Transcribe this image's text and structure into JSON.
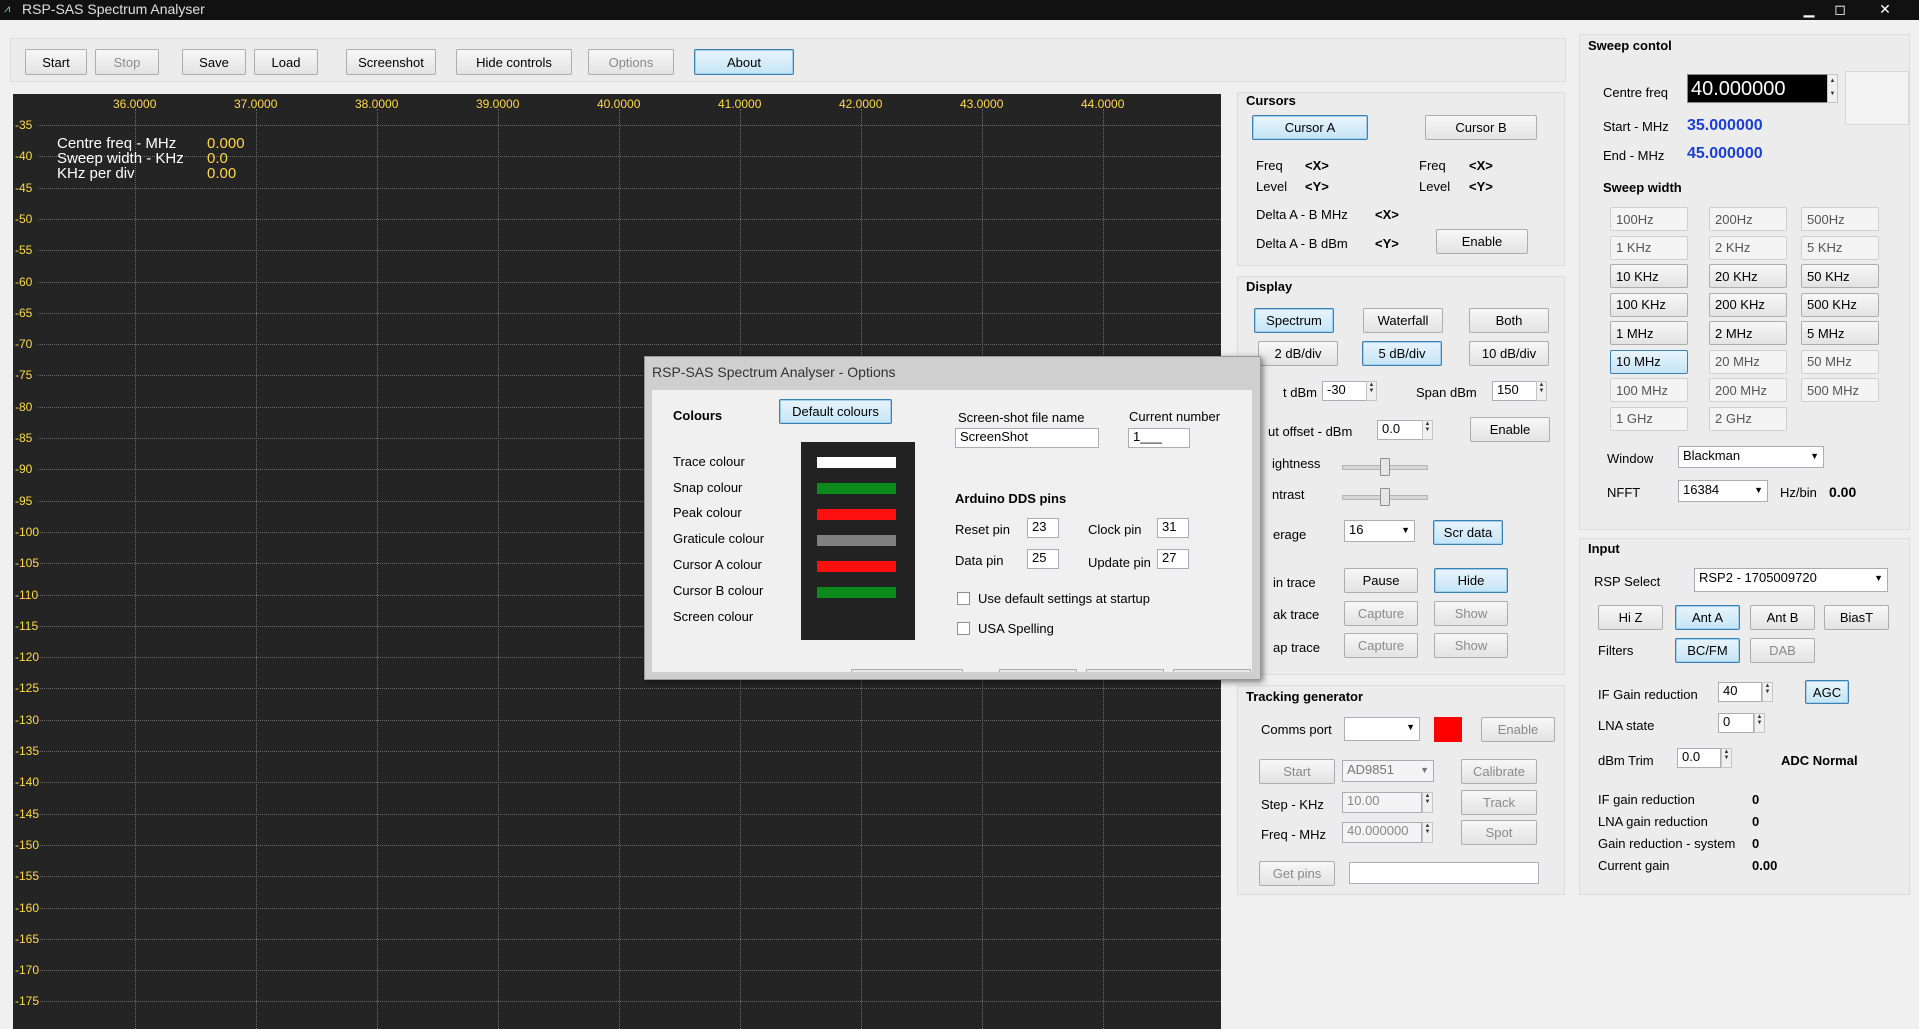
{
  "window": {
    "title": "RSP-SAS Spectrum Analyser",
    "min": "▁",
    "max": "◻",
    "close": "✕"
  },
  "toolbar": {
    "start": "Start",
    "stop": "Stop",
    "save": "Save",
    "load": "Load",
    "screenshot": "Screenshot",
    "hide_controls": "Hide controls",
    "options": "Options",
    "about": "About"
  },
  "spectrum": {
    "x_ticks": [
      "36.0000",
      "37.0000",
      "38.0000",
      "39.0000",
      "40.0000",
      "41.0000",
      "42.0000",
      "43.0000",
      "44.0000"
    ],
    "y_ticks": [
      "-35",
      "-40",
      "-45",
      "-50",
      "-55",
      "-60",
      "-65",
      "-70",
      "-75",
      "-80",
      "-85",
      "-90",
      "-95",
      "-100",
      "-105",
      "-110",
      "-115",
      "-120",
      "-125",
      "-130",
      "-135",
      "-140",
      "-145",
      "-150",
      "-155",
      "-160",
      "-165",
      "-170",
      "-175"
    ],
    "info": {
      "centre_label": "Centre freq - MHz",
      "centre_val": "0.000",
      "sweep_label": "Sweep width - KHz",
      "sweep_val": "0.0",
      "kpd_label": "KHz per div",
      "kpd_val": "0.00"
    },
    "colors": {
      "background": "#242424",
      "ticks": "#ffd84a",
      "grid": "#6a6a6a"
    }
  },
  "cursors": {
    "title": "Cursors",
    "cursor_a": "Cursor A",
    "cursor_b": "Cursor B",
    "freq": "Freq",
    "level": "Level",
    "x": "<X>",
    "y": "<Y>",
    "delta_mhz": "Delta A - B MHz",
    "delta_dbm": "Delta A - B dBm",
    "enable": "Enable"
  },
  "display": {
    "title": "Display",
    "spectrum": "Spectrum",
    "waterfall": "Waterfall",
    "both": "Both",
    "db2": "2 dB/div",
    "db5": "5 dB/div",
    "db10": "10 dB/div",
    "ref_label": "t dBm",
    "ref_val": "-30",
    "span_label": "Span dBm",
    "span_val": "150",
    "offset_label": "ut offset - dBm",
    "offset_val": "0.0",
    "enable": "Enable",
    "brightness": "ightness",
    "contrast": "ntrast",
    "brightness_level": 0.5,
    "contrast_level": 0.5,
    "average": "erage",
    "average_val": "16",
    "scr_data": "Scr data",
    "main_trace": "in trace",
    "pause": "Pause",
    "hide": "Hide",
    "peak_trace": "ak trace",
    "capture": "Capture",
    "show": "Show",
    "snap_trace": "ap trace"
  },
  "tracking": {
    "title": "Tracking generator",
    "comms": "Comms port",
    "enable": "Enable",
    "start": "Start",
    "chip": "AD9851",
    "calibrate": "Calibrate",
    "step_label": "Step - KHz",
    "step_val": "10.00",
    "track": "Track",
    "freq_label": "Freq - MHz",
    "freq_val": "40.000000",
    "spot": "Spot",
    "get_pins": "Get pins",
    "status_color": "#ff0000"
  },
  "sweep": {
    "title": "Sweep contol",
    "centre_label": "Centre freq",
    "centre_val": "40.000000",
    "start_label": "Start - MHz",
    "start_val": "35.000000",
    "end_label": "End - MHz",
    "end_val": "45.000000",
    "width_title": "Sweep width",
    "widths": [
      "100Hz",
      "200Hz",
      "500Hz",
      "1 KHz",
      "2 KHz",
      "5 KHz",
      "10 KHz",
      "20 KHz",
      "50 KHz",
      "100 KHz",
      "200 KHz",
      "500 KHz",
      "1 MHz",
      "2 MHz",
      "5 MHz",
      "10 MHz",
      "20 MHz",
      "50 MHz",
      "100 MHz",
      "200 MHz",
      "500 MHz",
      "1 GHz",
      "2 GHz"
    ],
    "window_label": "Window",
    "window_val": "Blackman",
    "nfft_label": "NFFT",
    "nfft_val": "16384",
    "hzbin_label": "Hz/bin",
    "hzbin_val": "0.00"
  },
  "input": {
    "title": "Input",
    "rsp_label": "RSP Select",
    "rsp_val": "RSP2 - 1705009720",
    "hiz": "Hi Z",
    "ant_a": "Ant A",
    "ant_b": "Ant B",
    "biast": "BiasT",
    "filters": "Filters",
    "bcfm": "BC/FM",
    "dab": "DAB",
    "if_gain_label": "IF Gain reduction",
    "if_gain_val": "40",
    "agc": "AGC",
    "lna_label": "LNA state",
    "lna_val": "0",
    "trim_label": "dBm Trim",
    "trim_val": "0.0",
    "adc": "ADC Normal",
    "if_red_label": "IF gain reduction",
    "if_red_val": "0",
    "lna_red_label": "LNA gain reduction",
    "lna_red_val": "0",
    "sys_red_label": "Gain reduction - system",
    "sys_red_val": "0",
    "cur_gain_label": "Current gain",
    "cur_gain_val": "0.00"
  },
  "options_dialog": {
    "title": "RSP-SAS Spectrum Analyser - Options",
    "colours": "Colours",
    "default_colours": "Default colours",
    "trace": "Trace colour",
    "snap": "Snap colour",
    "peak": "Peak colour",
    "graticule": "Graticule colour",
    "cursor_a": "Cursor A colour",
    "cursor_b": "Cursor B colour",
    "screen": "Screen colour",
    "swatches": {
      "trace": "#ffffff",
      "snap": "#0a8a1a",
      "peak": "#ff1010",
      "graticule": "#808080",
      "cursor_a": "#ff1010",
      "cursor_b": "#0a8a1a"
    },
    "ss_name_label": "Screen-shot file name",
    "ss_name_val": "ScreenShot",
    "cur_num_label": "Current number",
    "cur_num_val": "1___",
    "arduino": "Arduino DDS  pins",
    "reset_label": "Reset pin",
    "reset_val": "23",
    "clock_label": "Clock pin",
    "clock_val": "31",
    "data_label": "Data pin",
    "data_val": "25",
    "update_label": "Update pin",
    "update_val": "27",
    "use_default": "Use default settings at startup",
    "usa": "USA Spelling"
  }
}
